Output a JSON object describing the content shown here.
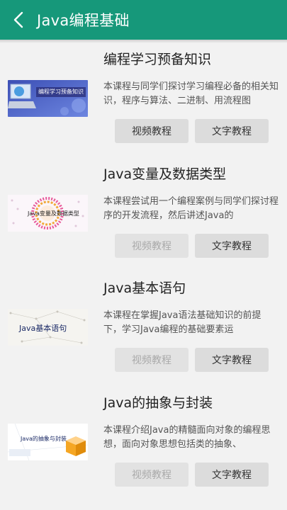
{
  "app_bar": {
    "title": "Java编程基础",
    "color": "#16987a"
  },
  "courses": [
    {
      "title": "编程学习预备知识",
      "description": "本课程与同学们探讨学习编程必备的相关知识，程序与算法、二进制、用流程图",
      "thumbnail_caption": "编程学习预备知识",
      "video_label": "视频教程",
      "video_enabled": true,
      "text_label": "文字教程"
    },
    {
      "title": "Java变量及数据类型",
      "description": "本课程尝试用一个编程案例与同学们探讨程序的开发流程，然后讲述Java的",
      "thumbnail_caption": "Java变量及数据类型",
      "video_label": "视频教程",
      "video_enabled": false,
      "text_label": "文字教程"
    },
    {
      "title": "Java基本语句",
      "description": "本课程在掌握Java语法基础知识的前提下，学习Java编程的基础要素运",
      "thumbnail_caption": "Java基本语句",
      "video_label": "视频教程",
      "video_enabled": false,
      "text_label": "文字教程"
    },
    {
      "title": "Java的抽象与封装",
      "description": "本课程介绍Java的精髓面向对象的编程思想，面向对象思想包括类的抽象、",
      "thumbnail_caption": "Java的抽象与封装",
      "video_label": "视频教程",
      "video_enabled": false,
      "text_label": "文字教程"
    }
  ]
}
